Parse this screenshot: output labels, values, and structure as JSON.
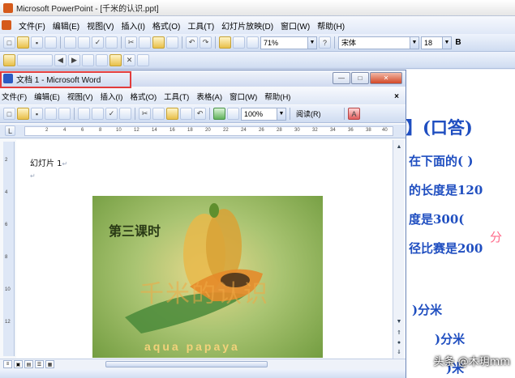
{
  "powerpoint": {
    "title": "Microsoft PowerPoint - [千米的认识.ppt]",
    "menu": [
      "文件(F)",
      "编辑(E)",
      "视图(V)",
      "插入(I)",
      "格式(O)",
      "工具(T)",
      "幻灯片放映(D)",
      "窗口(W)",
      "帮助(H)"
    ],
    "zoom": "71%",
    "font": "宋体",
    "font_size": "18",
    "bold_label": "B",
    "slide_lines": [
      "】(口答)",
      "在下面的(  )",
      "的长度是120",
      "度是300(",
      "径比赛是200",
      ")分米",
      ")分米",
      ")米"
    ],
    "slide_red": "分"
  },
  "word": {
    "title": "文档 1 - Microsoft Word",
    "menu": [
      "文件(F)",
      "编辑(E)",
      "视图(V)",
      "插入(I)",
      "格式(O)",
      "工具(T)",
      "表格(A)",
      "窗口(W)",
      "帮助(H)"
    ],
    "close_label": "×",
    "zoom": "100%",
    "read_mode": "阅读(R)",
    "ruler_ticks": [
      "2",
      "4",
      "6",
      "8",
      "10",
      "12",
      "14",
      "16",
      "18",
      "20",
      "22",
      "24",
      "26",
      "28",
      "30",
      "32",
      "34",
      "36",
      "38",
      "40"
    ],
    "document": {
      "paragraph1": "幻灯片 1",
      "image": {
        "title": "第三课时",
        "main_text": "千米的认识",
        "subtitle": "aqua papaya"
      }
    }
  },
  "watermark": "头条 @木玥mm"
}
